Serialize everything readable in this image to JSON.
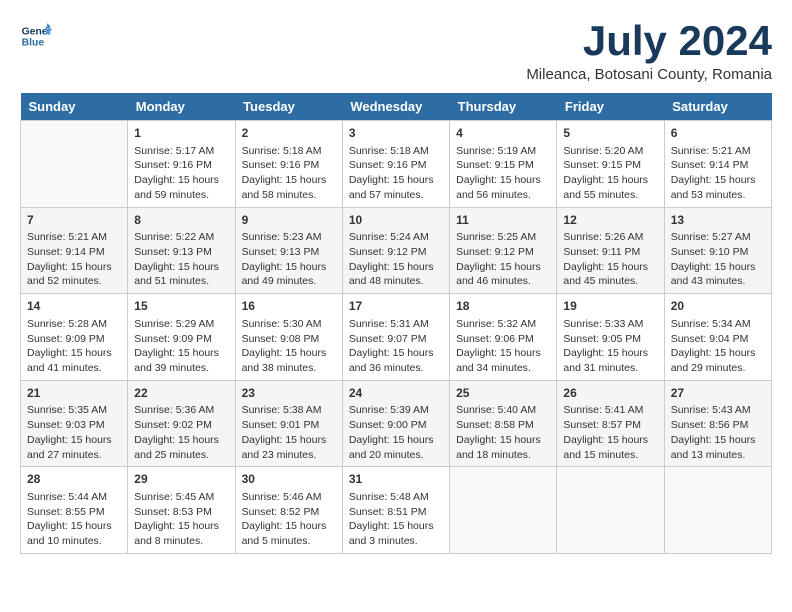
{
  "logo": {
    "line1": "General",
    "line2": "Blue"
  },
  "title": "July 2024",
  "subtitle": "Mileanca, Botosani County, Romania",
  "weekdays": [
    "Sunday",
    "Monday",
    "Tuesday",
    "Wednesday",
    "Thursday",
    "Friday",
    "Saturday"
  ],
  "weeks": [
    [
      {
        "day": "",
        "sunrise": "",
        "sunset": "",
        "daylight": ""
      },
      {
        "day": "1",
        "sunrise": "Sunrise: 5:17 AM",
        "sunset": "Sunset: 9:16 PM",
        "daylight": "Daylight: 15 hours and 59 minutes."
      },
      {
        "day": "2",
        "sunrise": "Sunrise: 5:18 AM",
        "sunset": "Sunset: 9:16 PM",
        "daylight": "Daylight: 15 hours and 58 minutes."
      },
      {
        "day": "3",
        "sunrise": "Sunrise: 5:18 AM",
        "sunset": "Sunset: 9:16 PM",
        "daylight": "Daylight: 15 hours and 57 minutes."
      },
      {
        "day": "4",
        "sunrise": "Sunrise: 5:19 AM",
        "sunset": "Sunset: 9:15 PM",
        "daylight": "Daylight: 15 hours and 56 minutes."
      },
      {
        "day": "5",
        "sunrise": "Sunrise: 5:20 AM",
        "sunset": "Sunset: 9:15 PM",
        "daylight": "Daylight: 15 hours and 55 minutes."
      },
      {
        "day": "6",
        "sunrise": "Sunrise: 5:21 AM",
        "sunset": "Sunset: 9:14 PM",
        "daylight": "Daylight: 15 hours and 53 minutes."
      }
    ],
    [
      {
        "day": "7",
        "sunrise": "Sunrise: 5:21 AM",
        "sunset": "Sunset: 9:14 PM",
        "daylight": "Daylight: 15 hours and 52 minutes."
      },
      {
        "day": "8",
        "sunrise": "Sunrise: 5:22 AM",
        "sunset": "Sunset: 9:13 PM",
        "daylight": "Daylight: 15 hours and 51 minutes."
      },
      {
        "day": "9",
        "sunrise": "Sunrise: 5:23 AM",
        "sunset": "Sunset: 9:13 PM",
        "daylight": "Daylight: 15 hours and 49 minutes."
      },
      {
        "day": "10",
        "sunrise": "Sunrise: 5:24 AM",
        "sunset": "Sunset: 9:12 PM",
        "daylight": "Daylight: 15 hours and 48 minutes."
      },
      {
        "day": "11",
        "sunrise": "Sunrise: 5:25 AM",
        "sunset": "Sunset: 9:12 PM",
        "daylight": "Daylight: 15 hours and 46 minutes."
      },
      {
        "day": "12",
        "sunrise": "Sunrise: 5:26 AM",
        "sunset": "Sunset: 9:11 PM",
        "daylight": "Daylight: 15 hours and 45 minutes."
      },
      {
        "day": "13",
        "sunrise": "Sunrise: 5:27 AM",
        "sunset": "Sunset: 9:10 PM",
        "daylight": "Daylight: 15 hours and 43 minutes."
      }
    ],
    [
      {
        "day": "14",
        "sunrise": "Sunrise: 5:28 AM",
        "sunset": "Sunset: 9:09 PM",
        "daylight": "Daylight: 15 hours and 41 minutes."
      },
      {
        "day": "15",
        "sunrise": "Sunrise: 5:29 AM",
        "sunset": "Sunset: 9:09 PM",
        "daylight": "Daylight: 15 hours and 39 minutes."
      },
      {
        "day": "16",
        "sunrise": "Sunrise: 5:30 AM",
        "sunset": "Sunset: 9:08 PM",
        "daylight": "Daylight: 15 hours and 38 minutes."
      },
      {
        "day": "17",
        "sunrise": "Sunrise: 5:31 AM",
        "sunset": "Sunset: 9:07 PM",
        "daylight": "Daylight: 15 hours and 36 minutes."
      },
      {
        "day": "18",
        "sunrise": "Sunrise: 5:32 AM",
        "sunset": "Sunset: 9:06 PM",
        "daylight": "Daylight: 15 hours and 34 minutes."
      },
      {
        "day": "19",
        "sunrise": "Sunrise: 5:33 AM",
        "sunset": "Sunset: 9:05 PM",
        "daylight": "Daylight: 15 hours and 31 minutes."
      },
      {
        "day": "20",
        "sunrise": "Sunrise: 5:34 AM",
        "sunset": "Sunset: 9:04 PM",
        "daylight": "Daylight: 15 hours and 29 minutes."
      }
    ],
    [
      {
        "day": "21",
        "sunrise": "Sunrise: 5:35 AM",
        "sunset": "Sunset: 9:03 PM",
        "daylight": "Daylight: 15 hours and 27 minutes."
      },
      {
        "day": "22",
        "sunrise": "Sunrise: 5:36 AM",
        "sunset": "Sunset: 9:02 PM",
        "daylight": "Daylight: 15 hours and 25 minutes."
      },
      {
        "day": "23",
        "sunrise": "Sunrise: 5:38 AM",
        "sunset": "Sunset: 9:01 PM",
        "daylight": "Daylight: 15 hours and 23 minutes."
      },
      {
        "day": "24",
        "sunrise": "Sunrise: 5:39 AM",
        "sunset": "Sunset: 9:00 PM",
        "daylight": "Daylight: 15 hours and 20 minutes."
      },
      {
        "day": "25",
        "sunrise": "Sunrise: 5:40 AM",
        "sunset": "Sunset: 8:58 PM",
        "daylight": "Daylight: 15 hours and 18 minutes."
      },
      {
        "day": "26",
        "sunrise": "Sunrise: 5:41 AM",
        "sunset": "Sunset: 8:57 PM",
        "daylight": "Daylight: 15 hours and 15 minutes."
      },
      {
        "day": "27",
        "sunrise": "Sunrise: 5:43 AM",
        "sunset": "Sunset: 8:56 PM",
        "daylight": "Daylight: 15 hours and 13 minutes."
      }
    ],
    [
      {
        "day": "28",
        "sunrise": "Sunrise: 5:44 AM",
        "sunset": "Sunset: 8:55 PM",
        "daylight": "Daylight: 15 hours and 10 minutes."
      },
      {
        "day": "29",
        "sunrise": "Sunrise: 5:45 AM",
        "sunset": "Sunset: 8:53 PM",
        "daylight": "Daylight: 15 hours and 8 minutes."
      },
      {
        "day": "30",
        "sunrise": "Sunrise: 5:46 AM",
        "sunset": "Sunset: 8:52 PM",
        "daylight": "Daylight: 15 hours and 5 minutes."
      },
      {
        "day": "31",
        "sunrise": "Sunrise: 5:48 AM",
        "sunset": "Sunset: 8:51 PM",
        "daylight": "Daylight: 15 hours and 3 minutes."
      },
      {
        "day": "",
        "sunrise": "",
        "sunset": "",
        "daylight": ""
      },
      {
        "day": "",
        "sunrise": "",
        "sunset": "",
        "daylight": ""
      },
      {
        "day": "",
        "sunrise": "",
        "sunset": "",
        "daylight": ""
      }
    ]
  ]
}
